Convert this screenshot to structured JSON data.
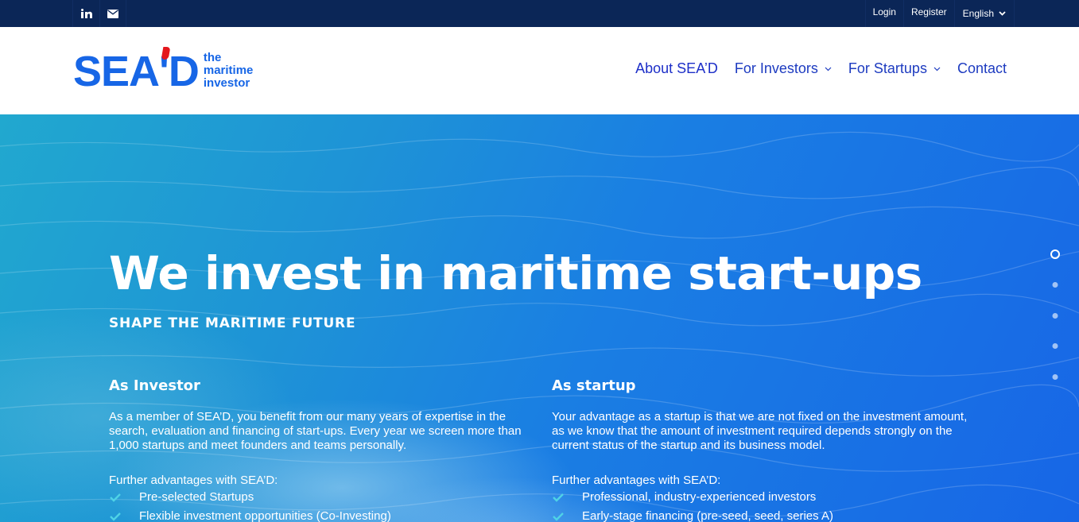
{
  "topbar": {
    "social": [
      {
        "icon": "linkedin-icon"
      },
      {
        "icon": "email-icon"
      }
    ],
    "login_label": "Login",
    "register_label": "Register",
    "language": "English"
  },
  "header": {
    "logo": {
      "mark": "SEA'D",
      "tagline_line1": "the",
      "tagline_line2": "maritime",
      "tagline_line3": "investor"
    },
    "nav": [
      {
        "label": "About SEA’D"
      },
      {
        "label": "For Investors",
        "has_dropdown": true
      },
      {
        "label": "For Startups",
        "has_dropdown": true
      },
      {
        "label": "Contact"
      }
    ]
  },
  "hero": {
    "title": "We invest in maritime start-ups",
    "subtitle": "SHAPE THE MARITIME FUTURE",
    "investor": {
      "heading": "As Investor",
      "body": "As a member of SEA’D, you benefit from our many years of expertise in the search, evaluation and financing of start-ups. Every year we screen more than 1,000 startups and meet founders and teams personally.",
      "advantages_heading": "Further advantages with SEA’D:",
      "advantages": [
        "Pre-selected Startups",
        "Flexible investment opportunities (Co-Investing)"
      ]
    },
    "startup": {
      "heading": "As startup",
      "body": "Your advantage as a startup is that we are not fixed on the investment amount, as we know that the amount of investment required depends strongly on the current status of the startup and its business model.",
      "advantages_heading": "Further advantages with SEA’D:",
      "advantages": [
        "Professional, industry-experienced investors",
        "Early-stage financing (pre-seed, seed, series A)"
      ]
    },
    "slider": {
      "count": 5,
      "active_index": 0
    }
  },
  "colors": {
    "topbar": "#0b2657",
    "brand_blue": "#1766e6",
    "brand_red": "#e4171d",
    "nav_text": "#1d3bc0",
    "check": "#4fd3e6"
  }
}
